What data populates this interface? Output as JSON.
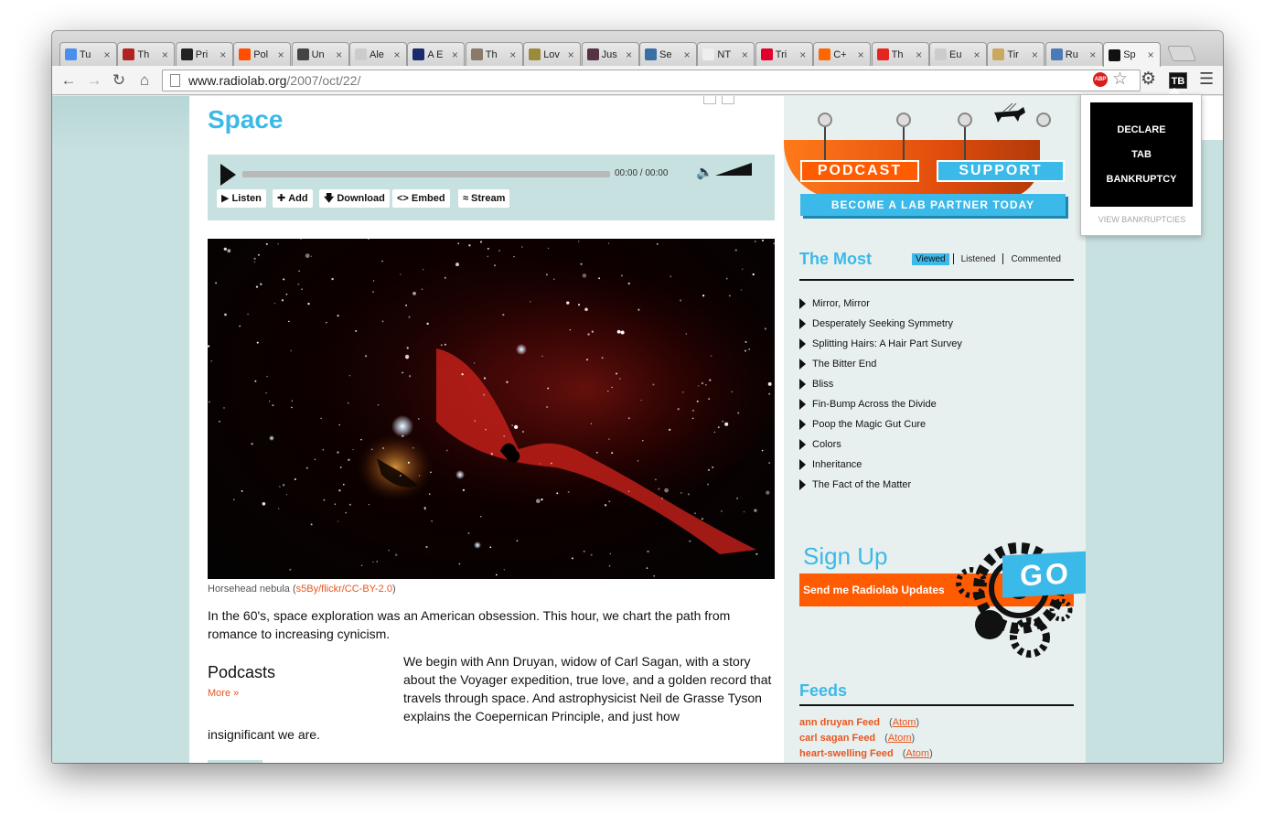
{
  "browser": {
    "tabs": [
      {
        "title": "Tu",
        "favicon": "chrome-logo-icon",
        "color": "#4a8ef0"
      },
      {
        "title": "Th",
        "favicon": "books-icon",
        "color": "#b22222"
      },
      {
        "title": "Pri",
        "favicon": "wp-logo-icon",
        "color": "#222222"
      },
      {
        "title": "Pol",
        "favicon": "ars-logo-icon",
        "color": "#ff4e00"
      },
      {
        "title": "Un",
        "favicon": "wsj-logo-icon",
        "color": "#444444"
      },
      {
        "title": "Ale",
        "favicon": "page-icon",
        "color": "#cccccc"
      },
      {
        "title": "A E",
        "favicon": "f-logo-icon",
        "color": "#1a2a6c"
      },
      {
        "title": "Th",
        "favicon": "person-avatar-icon",
        "color": "#8a7a6a"
      },
      {
        "title": "Lov",
        "favicon": "photo-icon",
        "color": "#9a8a3a"
      },
      {
        "title": "Jus",
        "favicon": "portrait-icon",
        "color": "#553344"
      },
      {
        "title": "Se",
        "favicon": "f-blue-logo-icon",
        "color": "#3a6ea5"
      },
      {
        "title": "NT",
        "favicon": "wiki-logo-icon",
        "color": "#eeeeee"
      },
      {
        "title": "Tri",
        "favicon": "shield-red-icon",
        "color": "#e0002a"
      },
      {
        "title": "C+",
        "favicon": "blogger-logo-icon",
        "color": "#ff6600"
      },
      {
        "title": "Th",
        "favicon": "red-square-icon",
        "color": "#e5261f"
      },
      {
        "title": "Eu",
        "favicon": "page-icon",
        "color": "#cccccc"
      },
      {
        "title": "Tir",
        "favicon": "dog-icon",
        "color": "#caa860"
      },
      {
        "title": "Ru",
        "favicon": "shield-blue-icon",
        "color": "#4a7ab8"
      },
      {
        "title": "Sp",
        "favicon": "radiolab-logo-icon",
        "color": "#111111",
        "active": true
      }
    ],
    "url_host": "www.radiolab.org",
    "url_path": "/2007/oct/22/",
    "extension_label": "TB"
  },
  "popup": {
    "line1": "DECLARE",
    "line2": "TAB",
    "line3": "BANKRUPTCY",
    "view_link": "VIEW BANKRUPTCIES"
  },
  "page": {
    "title": "Space",
    "player": {
      "time": "00:00 / 00:00",
      "buttons": [
        "Listen",
        "Add",
        "Download",
        "Embed",
        "Stream"
      ]
    },
    "caption_text": "Horsehead nebula (",
    "caption_link": "s5By/flickr/CC-BY-2.0",
    "caption_end": ")",
    "intro": "In the 60's, space exploration was an American obsession. This hour, we chart the path from romance to increasing cynicism.",
    "podcasts_heading": "Podcasts",
    "more_link": "More »",
    "body": "We begin with Ann Druyan, widow of Carl Sagan, with a story about the Voyager expedition, true love, and a golden record that travels through space. And astrophysicist Neil de Grasse Tyson explains the Coepernican Principle, and just how",
    "body_end": "insignificant we are."
  },
  "sidebar": {
    "podcast_btn": "PODCAST",
    "support_btn": "SUPPORT",
    "partner_btn": "BECOME A LAB PARTNER TODAY",
    "most_title": "The Most",
    "most_tabs": [
      "Viewed",
      "Listened",
      "Commented"
    ],
    "most_items": [
      "Mirror, Mirror",
      "Desperately Seeking Symmetry",
      "Splitting Hairs: A Hair Part Survey",
      "The Bitter End",
      "Bliss",
      "Fin-Bump Across the Divide",
      "Poop the Magic Gut Cure",
      "Colors",
      "Inheritance",
      "The Fact of the Matter"
    ],
    "signup_title": "Sign Up",
    "signup_bar": "Send me Radiolab Updates",
    "go_label": "GO",
    "feeds_title": "Feeds",
    "feeds": [
      {
        "name": "ann druyan Feed",
        "atom": "Atom"
      },
      {
        "name": "carl sagan Feed",
        "atom": "Atom"
      },
      {
        "name": "heart-swelling Feed",
        "atom": "Atom"
      }
    ]
  },
  "colors": {
    "accent_blue": "#3bb9e8",
    "accent_orange": "#ff5b00",
    "link_orange": "#e8551f",
    "page_bg": "#c7e0e0"
  }
}
